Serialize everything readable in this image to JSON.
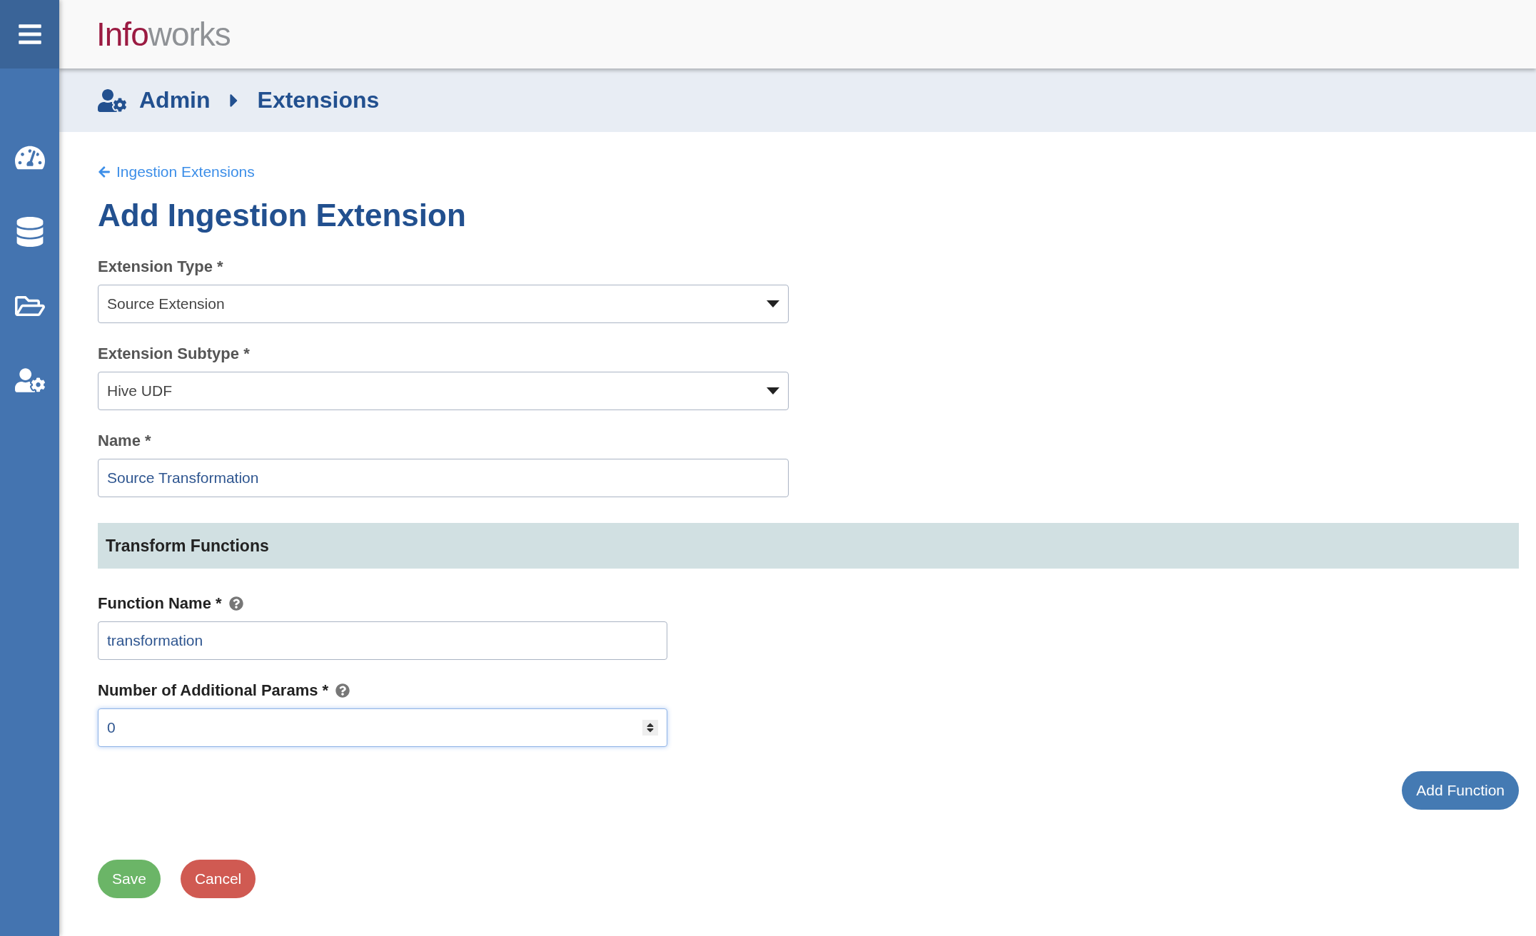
{
  "logo": {
    "accent": "Info",
    "rest": "works"
  },
  "sidebar": {
    "items": [
      {
        "kind": "dashboard"
      },
      {
        "kind": "data"
      },
      {
        "kind": "files"
      },
      {
        "kind": "admin"
      }
    ]
  },
  "breadcrumb": [
    "Admin",
    "Extensions"
  ],
  "back_link": "Ingestion Extensions",
  "title": "Add Ingestion Extension",
  "fields": [
    {
      "kind": "select",
      "label": "Extension Type *",
      "value": "Source Extension"
    },
    {
      "kind": "select",
      "label": "Extension Subtype *",
      "value": "Hive UDF"
    },
    {
      "kind": "text",
      "label": "Name *",
      "value": "Source Transformation"
    }
  ],
  "section": {
    "title": "Transform Functions",
    "fields": [
      {
        "kind": "text",
        "label": "Function Name *",
        "help": true,
        "value": "transformation",
        "focused": false
      },
      {
        "kind": "number",
        "label": "Number of Additional Params *",
        "help": true,
        "value": "0",
        "focused": true
      }
    ],
    "add_button": "Add Function"
  },
  "buttons": [
    {
      "kind": "save",
      "label": "Save"
    },
    {
      "kind": "cancel",
      "label": "Cancel"
    }
  ]
}
